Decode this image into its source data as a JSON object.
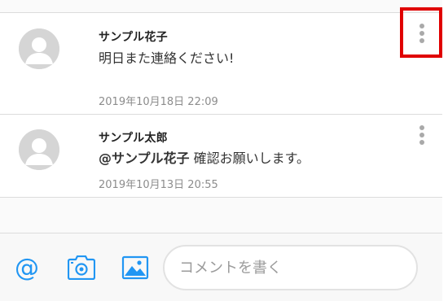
{
  "comments": [
    {
      "author": "サンプル花子",
      "mention": "",
      "text": "明日また連絡ください!",
      "timestamp": "2019年10月18日 22:09",
      "avatar_icon": "user-avatar-icon",
      "menu_icon": "more-vertical-icon"
    },
    {
      "author": "サンプル太郎",
      "mention": "@サンプル花子",
      "text": " 確認お願いします。",
      "timestamp": "2019年10月13日 20:55",
      "avatar_icon": "user-avatar-icon",
      "menu_icon": "more-vertical-icon"
    }
  ],
  "composer": {
    "placeholder": "コメントを書く",
    "tools": [
      {
        "icon": "at-mention-icon"
      },
      {
        "icon": "camera-icon"
      },
      {
        "icon": "image-icon"
      }
    ]
  },
  "colors": {
    "accent": "#2196f3",
    "highlight": "#e00000",
    "divider": "#dcdcdc",
    "muted_text": "#8c8c8c"
  }
}
